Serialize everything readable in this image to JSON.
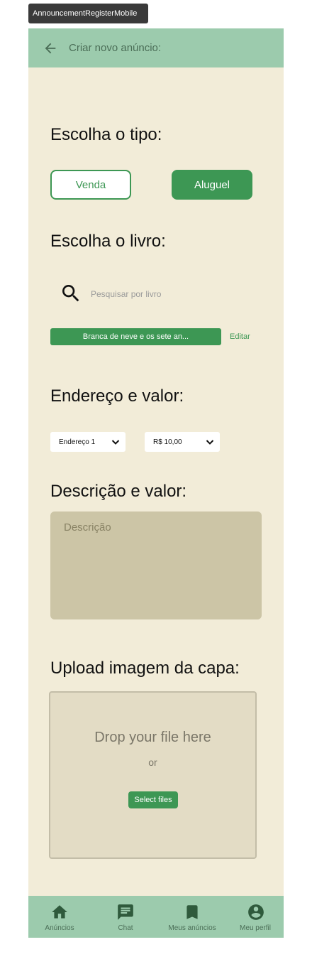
{
  "frame_label": "AnnouncementRegisterMobile",
  "header": {
    "title": "Criar novo anúncio:"
  },
  "type_section": {
    "title": "Escolha o tipo:",
    "option_sale": "Venda",
    "option_rent": "Aluguel",
    "selected": "Aluguel"
  },
  "book_section": {
    "title": "Escolha o livro:",
    "search_placeholder": "Pesquisar por livro",
    "selected_book": "Branca de neve e os sete an...",
    "edit_label": "Editar"
  },
  "address_section": {
    "title": "Endereço e valor:",
    "address_value": "Endereço 1",
    "price_value": "R$ 10,00"
  },
  "description_section": {
    "title": "Descrição e valor:",
    "placeholder": "Descrição"
  },
  "upload_section": {
    "title": "Upload imagem da capa:",
    "drop_text": "Drop your file here",
    "or_text": "or",
    "button_label": "Select files"
  },
  "bottom_nav": {
    "items": [
      {
        "label": "Anúncios",
        "icon": "home-icon"
      },
      {
        "label": "Chat",
        "icon": "chat-icon"
      },
      {
        "label": "Meus anúncios",
        "icon": "bookmark-icon"
      },
      {
        "label": "Meu perfil",
        "icon": "account-icon"
      }
    ]
  },
  "colors": {
    "header_bg": "#9ccbad",
    "page_bg": "#f2ecd8",
    "accent": "#3d9754",
    "textarea_bg": "#ccc5a6",
    "dropzone_bg": "#e3dcc5"
  }
}
